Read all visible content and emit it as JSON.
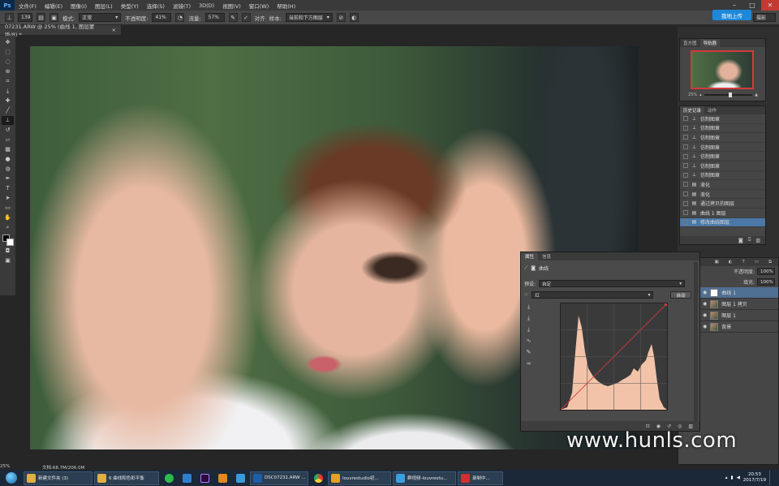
{
  "app": {
    "logo": "Ps",
    "menus": [
      "文件(F)",
      "编辑(E)",
      "图像(I)",
      "图层(L)",
      "类型(Y)",
      "选择(S)",
      "滤镜(T)",
      "3D(D)",
      "视图(V)",
      "窗口(W)",
      "帮助(H)"
    ],
    "window_controls": [
      "–",
      "□",
      "✕"
    ]
  },
  "options_bar": {
    "brush_size": "139",
    "mode_label": "模式:",
    "mode_value": "正常",
    "opacity_label": "不透明度:",
    "opacity_value": "41%",
    "flow_label": "流量:",
    "flow_value": "57%",
    "align_label": "对齐",
    "sample_label": "样本:",
    "sample_value": "当前和下方图层",
    "upload_label": "我地上传",
    "workspace_value": "摄影"
  },
  "document": {
    "tab_title": "07231.ARW @ 25% (曲线 1, 图层蒙版/8) *",
    "zoom": "25%",
    "doc_size": "文档:68.7M/206.0M"
  },
  "tools": [
    "move",
    "marquee",
    "lasso",
    "quick-select",
    "crop",
    "eyedropper",
    "healing",
    "brush",
    "clone-stamp",
    "history-brush",
    "eraser",
    "gradient",
    "blur",
    "dodge",
    "pen",
    "type",
    "path-select",
    "shape",
    "hand",
    "zoom"
  ],
  "navigator": {
    "tabs": [
      "直方图",
      "导航器"
    ],
    "zoom": "25%"
  },
  "history": {
    "tabs": [
      "历史记录",
      "动作"
    ],
    "items": [
      {
        "label": "仿制图章",
        "icon": "stamp"
      },
      {
        "label": "仿制图章",
        "icon": "stamp"
      },
      {
        "label": "仿制图章",
        "icon": "stamp"
      },
      {
        "label": "仿制图章",
        "icon": "stamp"
      },
      {
        "label": "仿制图章",
        "icon": "stamp"
      },
      {
        "label": "仿制图章",
        "icon": "stamp"
      },
      {
        "label": "仿制图章",
        "icon": "stamp"
      },
      {
        "label": "液化",
        "icon": "doc"
      },
      {
        "label": "液化",
        "icon": "doc"
      },
      {
        "label": "通过拷贝的图层",
        "icon": "doc"
      },
      {
        "label": "曲线 1 图层",
        "icon": "doc"
      },
      {
        "label": "修改曲线图层",
        "icon": "doc"
      }
    ],
    "selected_index": 11
  },
  "properties": {
    "tabs": [
      "属性",
      "信息"
    ],
    "title": "曲线",
    "preset_label": "预设:",
    "preset_value": "自定",
    "channel_value": "红",
    "auto_label": "自动"
  },
  "layers": {
    "opacity_label": "不透明度:",
    "opacity_value": "100%",
    "fill_label": "填充:",
    "fill_value": "100%",
    "items": [
      {
        "name": "曲线 1",
        "thumb": "white"
      },
      {
        "name": "图层 1 拷贝",
        "thumb": "photo"
      },
      {
        "name": "图层 1",
        "thumb": "photo"
      },
      {
        "name": "背景",
        "thumb": "photo"
      }
    ],
    "selected_index": 0
  },
  "watermark": "www.hunls.com",
  "taskbar": {
    "items": [
      {
        "label": "新建文件夹 (3)",
        "color": "#e0b040"
      },
      {
        "label": "6 曲线和色彩平衡",
        "color": "#e0b040"
      },
      {
        "label": "DSC07231.ARW ...",
        "color": "#1c5ea8"
      },
      {
        "label": "louvrestudio初...",
        "color": "#e8a020"
      },
      {
        "label": "群视频-louvrestu...",
        "color": "#3aa0e0"
      },
      {
        "label": "录制中...",
        "color": "#d03030"
      }
    ],
    "time": "20:53",
    "date": "2017/7/19"
  },
  "colors": {
    "accent": "#1e88d8",
    "selected": "#4b78a6",
    "histogram": "#f2c3a8",
    "curve": "#d23b3b"
  }
}
